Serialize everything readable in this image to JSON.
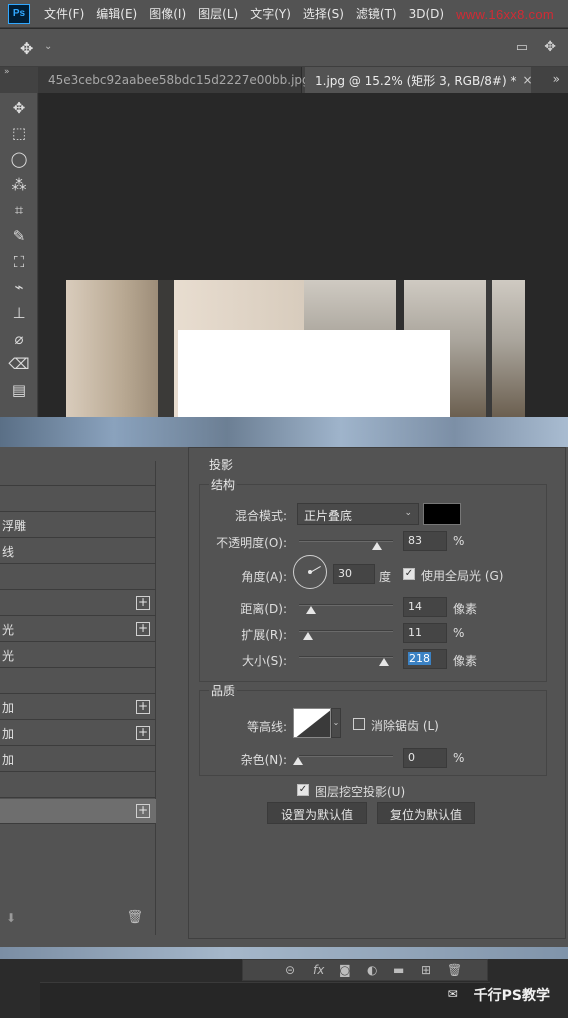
{
  "menubar": {
    "logo": "Ps",
    "items": [
      "文件(F)",
      "编辑(E)",
      "图像(I)",
      "图层(L)",
      "文字(Y)",
      "选择(S)",
      "滤镜(T)",
      "3D(D)"
    ],
    "watermark": "www.16xx8.com"
  },
  "optionsbar": {
    "tool_icon": "✥",
    "chevron": "⌄",
    "right_icon_1": "▭",
    "right_icon_2": "✥"
  },
  "tabs": {
    "inactive": "45e3cebc92aabee58bdc15d2227e00bb.jpg",
    "active": "1.jpg @ 15.2% (矩形 3, RGB/8#) *",
    "close": "×",
    "overflow": "»"
  },
  "toolbar": {
    "tools": [
      "✥",
      "⬚",
      "◯",
      "⁂",
      "⌗",
      "✎",
      "⛶",
      "⌁",
      "⊥",
      "⌀",
      "⌫",
      "▤"
    ]
  },
  "style_list": {
    "rows": [
      {
        "label": ""
      },
      {
        "label": ""
      },
      {
        "label": "斜面和浮雕",
        "display": "浮雕"
      },
      {
        "label": "等高线",
        "display": "线"
      },
      {
        "label": ""
      },
      {
        "label": "",
        "plus": true
      },
      {
        "label": "",
        "display": "光",
        "plus": true
      },
      {
        "label": "",
        "display": "光"
      },
      {
        "label": ""
      },
      {
        "label": "",
        "display": "加",
        "plus": true
      },
      {
        "label": "",
        "display": "加",
        "plus": true
      },
      {
        "label": "",
        "display": "加"
      },
      {
        "label": ""
      },
      {
        "label": "",
        "plus": true
      }
    ],
    "plus_symbol": "+",
    "bottom_left": "⬇",
    "bottom_right": "🗑"
  },
  "shadow": {
    "title": "投影",
    "structure_title": "结构",
    "blend_mode_label": "混合模式:",
    "blend_mode_value": "正片叠底",
    "shadow_color": "#000000",
    "opacity_label": "不透明度(O):",
    "opacity_value": "83",
    "opacity_unit": "%",
    "opacity_percent": 83,
    "angle_label": "角度(A):",
    "angle_value": "30",
    "angle_unit": "度",
    "global_light_label": "使用全局光 (G)",
    "global_light_checked": true,
    "distance_label": "距离(D):",
    "distance_value": "14",
    "distance_unit": "像素",
    "spread_label": "扩展(R):",
    "spread_value": "11",
    "spread_unit": "%",
    "size_label": "大小(S):",
    "size_value": "218",
    "size_unit": "像素",
    "quality_title": "品质",
    "contour_label": "等高线:",
    "antialias_label": "消除锯齿 (L)",
    "antialias_checked": false,
    "noise_label": "杂色(N):",
    "noise_value": "0",
    "noise_unit": "%",
    "knockout_label": "图层挖空投影(U)",
    "knockout_checked": true,
    "make_default": "设置为默认值",
    "reset_default": "复位为默认值"
  },
  "layers": {
    "icons": [
      "⊝",
      "fx",
      "◙",
      "◐",
      "▬",
      "⊞",
      "🗑"
    ]
  },
  "brand": {
    "icon": "✉",
    "text": "千行PS教学"
  }
}
